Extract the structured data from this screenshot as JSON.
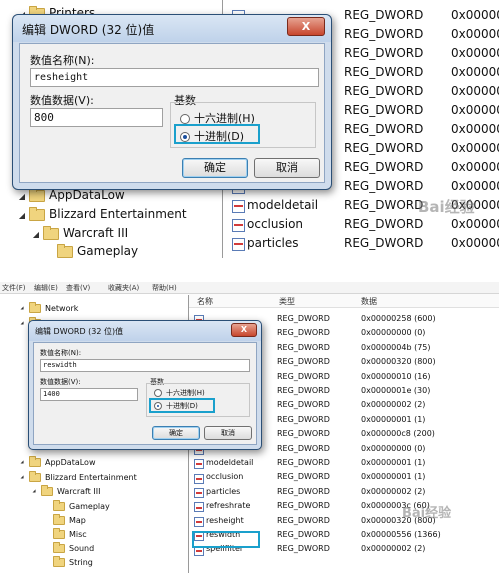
{
  "top": {
    "tree": [
      {
        "label": "Printers",
        "indent": 1,
        "folder": true
      },
      {
        "label": "AppDataLow",
        "indent": 1,
        "folder": true
      },
      {
        "label": "Blizzard Entertainment",
        "indent": 1,
        "folder": true
      },
      {
        "label": "Warcraft III",
        "indent": 2,
        "folder": true
      },
      {
        "label": "Gameplay",
        "indent": 3,
        "folder": true
      }
    ],
    "values": [
      {
        "name": "",
        "type": "REG_DWORD",
        "data": "0x000000"
      },
      {
        "name": "",
        "type": "REG_DWORD",
        "data": "0x000000"
      },
      {
        "name": "",
        "type": "REG_DWORD",
        "data": "0x000000"
      },
      {
        "name": "",
        "type": "REG_DWORD",
        "data": "0x000000"
      },
      {
        "name": "",
        "type": "REG_DWORD",
        "data": "0x000000"
      },
      {
        "name": "",
        "type": "REG_DWORD",
        "data": "0x000000"
      },
      {
        "name": "",
        "type": "REG_DWORD",
        "data": "0x000000"
      },
      {
        "name": "",
        "type": "REG_DWORD",
        "data": "0x000000"
      },
      {
        "name": "",
        "type": "REG_DWORD",
        "data": "0x000000"
      },
      {
        "name": "",
        "type": "REG_DWORD",
        "data": "0x000000"
      },
      {
        "name": "modeldetail",
        "type": "REG_DWORD",
        "data": "0x000000"
      },
      {
        "name": "occlusion",
        "type": "REG_DWORD",
        "data": "0x000000"
      },
      {
        "name": "particles",
        "type": "REG_DWORD",
        "data": "0x000000"
      }
    ],
    "dialog": {
      "title": "编辑 DWORD (32 位)值",
      "close": "X",
      "name_label": "数值名称(N):",
      "name_value": "resheight",
      "data_label": "数值数据(V):",
      "data_value": "800",
      "base_label": "基数",
      "hex_label": "十六进制(H)",
      "dec_label": "十进制(D)",
      "ok": "确定",
      "cancel": "取消"
    }
  },
  "bottom": {
    "menu": [
      "文件(F)",
      "编辑(E)",
      "查看(V)",
      "收藏夹(A)",
      "帮助(H)"
    ],
    "columns": {
      "name": "名称",
      "type": "类型",
      "data": "数据"
    },
    "tree": [
      {
        "label": "Network",
        "indent": 1
      },
      {
        "label": "Printers",
        "indent": 1
      },
      {
        "label": "AppDataLow",
        "indent": 1
      },
      {
        "label": "Blizzard Entertainment",
        "indent": 1
      },
      {
        "label": "Warcraft III",
        "indent": 2
      },
      {
        "label": "Gameplay",
        "indent": 3
      },
      {
        "label": "Map",
        "indent": 3
      },
      {
        "label": "Misc",
        "indent": 3
      },
      {
        "label": "Sound",
        "indent": 3
      },
      {
        "label": "String",
        "indent": 3
      }
    ],
    "values": [
      {
        "name": "",
        "type": "REG_DWORD",
        "data": "0x00000258 (600)"
      },
      {
        "name": "",
        "type": "REG_DWORD",
        "data": "0x00000000 (0)"
      },
      {
        "name": "",
        "type": "REG_DWORD",
        "data": "0x0000004b (75)"
      },
      {
        "name": "",
        "type": "REG_DWORD",
        "data": "0x00000320 (800)"
      },
      {
        "name": "",
        "type": "REG_DWORD",
        "data": "0x00000010 (16)"
      },
      {
        "name": "",
        "type": "REG_DWORD",
        "data": "0x0000001e (30)"
      },
      {
        "name": "",
        "type": "REG_DWORD",
        "data": "0x00000002 (2)"
      },
      {
        "name": "",
        "type": "REG_DWORD",
        "data": "0x00000001 (1)"
      },
      {
        "name": "",
        "type": "REG_DWORD",
        "data": "0x000000c8 (200)"
      },
      {
        "name": "",
        "type": "REG_DWORD",
        "data": "0x00000000 (0)"
      },
      {
        "name": "modeldetail",
        "type": "REG_DWORD",
        "data": "0x00000001 (1)"
      },
      {
        "name": "occlusion",
        "type": "REG_DWORD",
        "data": "0x00000001 (1)"
      },
      {
        "name": "particles",
        "type": "REG_DWORD",
        "data": "0x00000002 (2)"
      },
      {
        "name": "refreshrate",
        "type": "REG_DWORD",
        "data": "0x0000003c (60)"
      },
      {
        "name": "resheight",
        "type": "REG_DWORD",
        "data": "0x00000320 (800)"
      },
      {
        "name": "reswidth",
        "type": "REG_DWORD",
        "data": "0x00000556 (1366)"
      },
      {
        "name": "spellfilter",
        "type": "REG_DWORD",
        "data": "0x00000002 (2)"
      }
    ],
    "dialog": {
      "title": "编辑 DWORD (32 位)值",
      "close": "X",
      "name_label": "数值名称(N):",
      "name_value": "reswidth",
      "data_label": "数值数据(V):",
      "data_value": "1400",
      "base_label": "基数",
      "hex_label": "十六进制(H)",
      "dec_label": "十进制(D)",
      "ok": "确定",
      "cancel": "取消"
    }
  },
  "watermark": "Bai经验"
}
